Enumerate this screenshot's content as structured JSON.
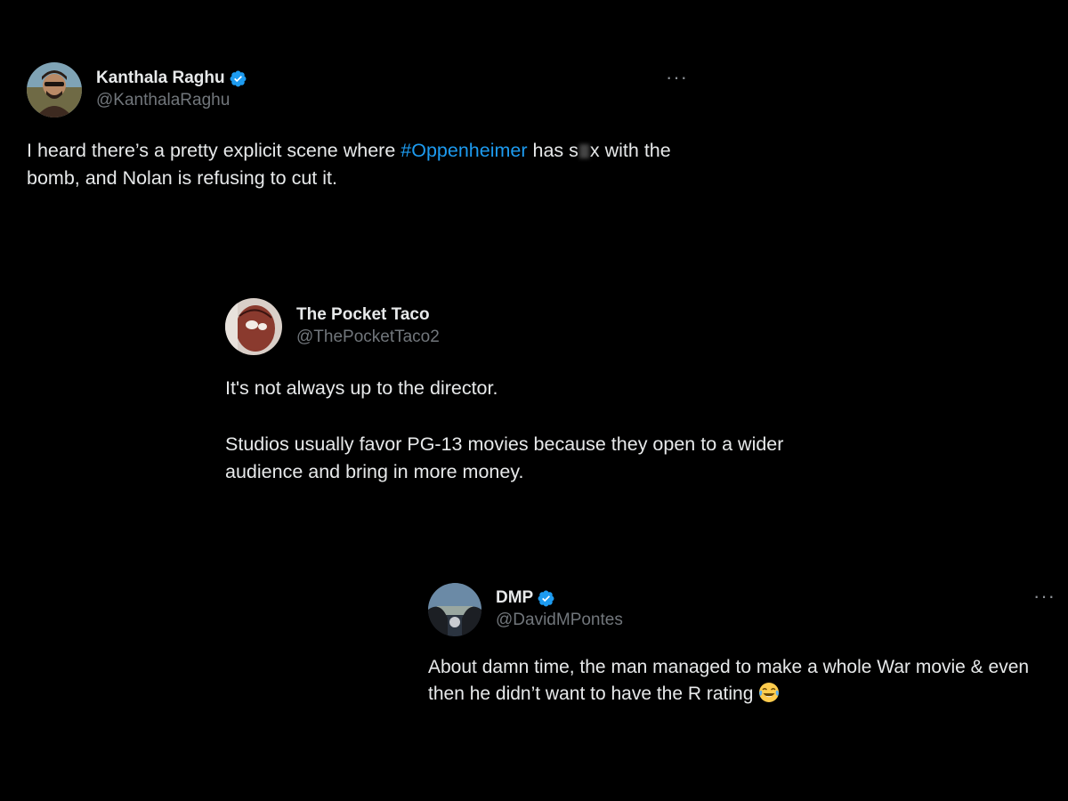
{
  "colors": {
    "background": "#000000",
    "text": "#e7e9ea",
    "muted": "#71767b",
    "accent": "#1d9bf0"
  },
  "tweets": [
    {
      "display_name": "Kanthala Raghu",
      "handle": "@KanthalaRaghu",
      "verified": true,
      "more_icon": "more-horizontal-icon",
      "text_before_tag": "I heard there’s a pretty explicit scene where ",
      "hashtag": "#Oppenheimer",
      "text_mid_1": " has s",
      "text_mid_2": "x with the bomb, and Nolan is refusing to cut it."
    },
    {
      "display_name": "The Pocket Taco",
      "handle": "@ThePocketTaco2",
      "verified": false,
      "paragraph_1": "It's not always up to the director.",
      "paragraph_2": "Studios usually favor PG-13 movies because they open to a wider audience and bring in more money."
    },
    {
      "display_name": "DMP",
      "handle": "@DavidMPontes",
      "verified": true,
      "more_icon": "more-horizontal-icon",
      "text": "About damn time, the man managed to make a whole War movie & even then he didn’t want to have the R rating ",
      "emoji": "face-with-tears-of-joy-icon"
    }
  ]
}
